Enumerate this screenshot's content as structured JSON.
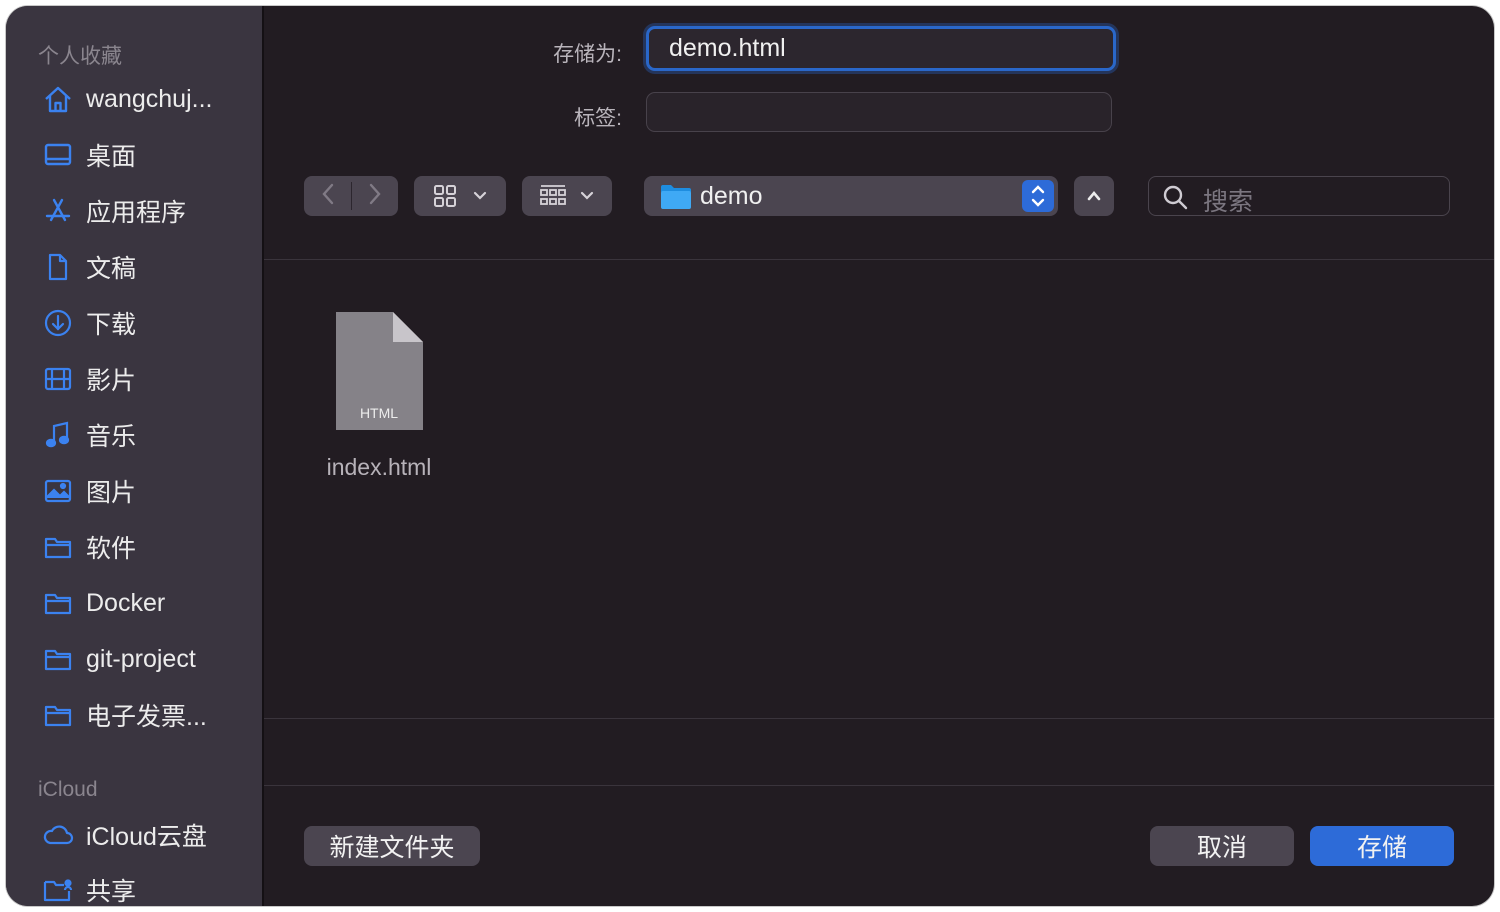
{
  "sidebar": {
    "favorites_header": "个人收藏",
    "favorites": [
      {
        "label": "wangchuj...",
        "icon": "home-icon"
      },
      {
        "label": "桌面",
        "icon": "desktop-icon"
      },
      {
        "label": "应用程序",
        "icon": "applications-icon"
      },
      {
        "label": "文稿",
        "icon": "document-icon"
      },
      {
        "label": "下载",
        "icon": "download-icon"
      },
      {
        "label": "影片",
        "icon": "film-icon"
      },
      {
        "label": "音乐",
        "icon": "music-icon"
      },
      {
        "label": "图片",
        "icon": "picture-icon"
      },
      {
        "label": "软件",
        "icon": "folder-icon"
      },
      {
        "label": "Docker",
        "icon": "folder-icon"
      },
      {
        "label": "git-project",
        "icon": "folder-icon"
      },
      {
        "label": "电子发票...",
        "icon": "folder-icon"
      }
    ],
    "icloud_header": "iCloud",
    "icloud": [
      {
        "label": "iCloud云盘",
        "icon": "cloud-icon"
      },
      {
        "label": "共享",
        "icon": "shared-folder-icon"
      }
    ]
  },
  "save_as": {
    "label": "存储为:",
    "value": "demo.html"
  },
  "tags": {
    "label": "标签:",
    "value": ""
  },
  "toolbar": {
    "location": "demo",
    "search_placeholder": "搜索"
  },
  "files": [
    {
      "name": "index.html",
      "type_label": "HTML"
    }
  ],
  "buttons": {
    "new_folder": "新建文件夹",
    "cancel": "取消",
    "save": "存储"
  },
  "colors": {
    "accent": "#2d6bd8",
    "icon_blue": "#3b82f0",
    "background": "#221c22",
    "sidebar": "#3a3540"
  }
}
